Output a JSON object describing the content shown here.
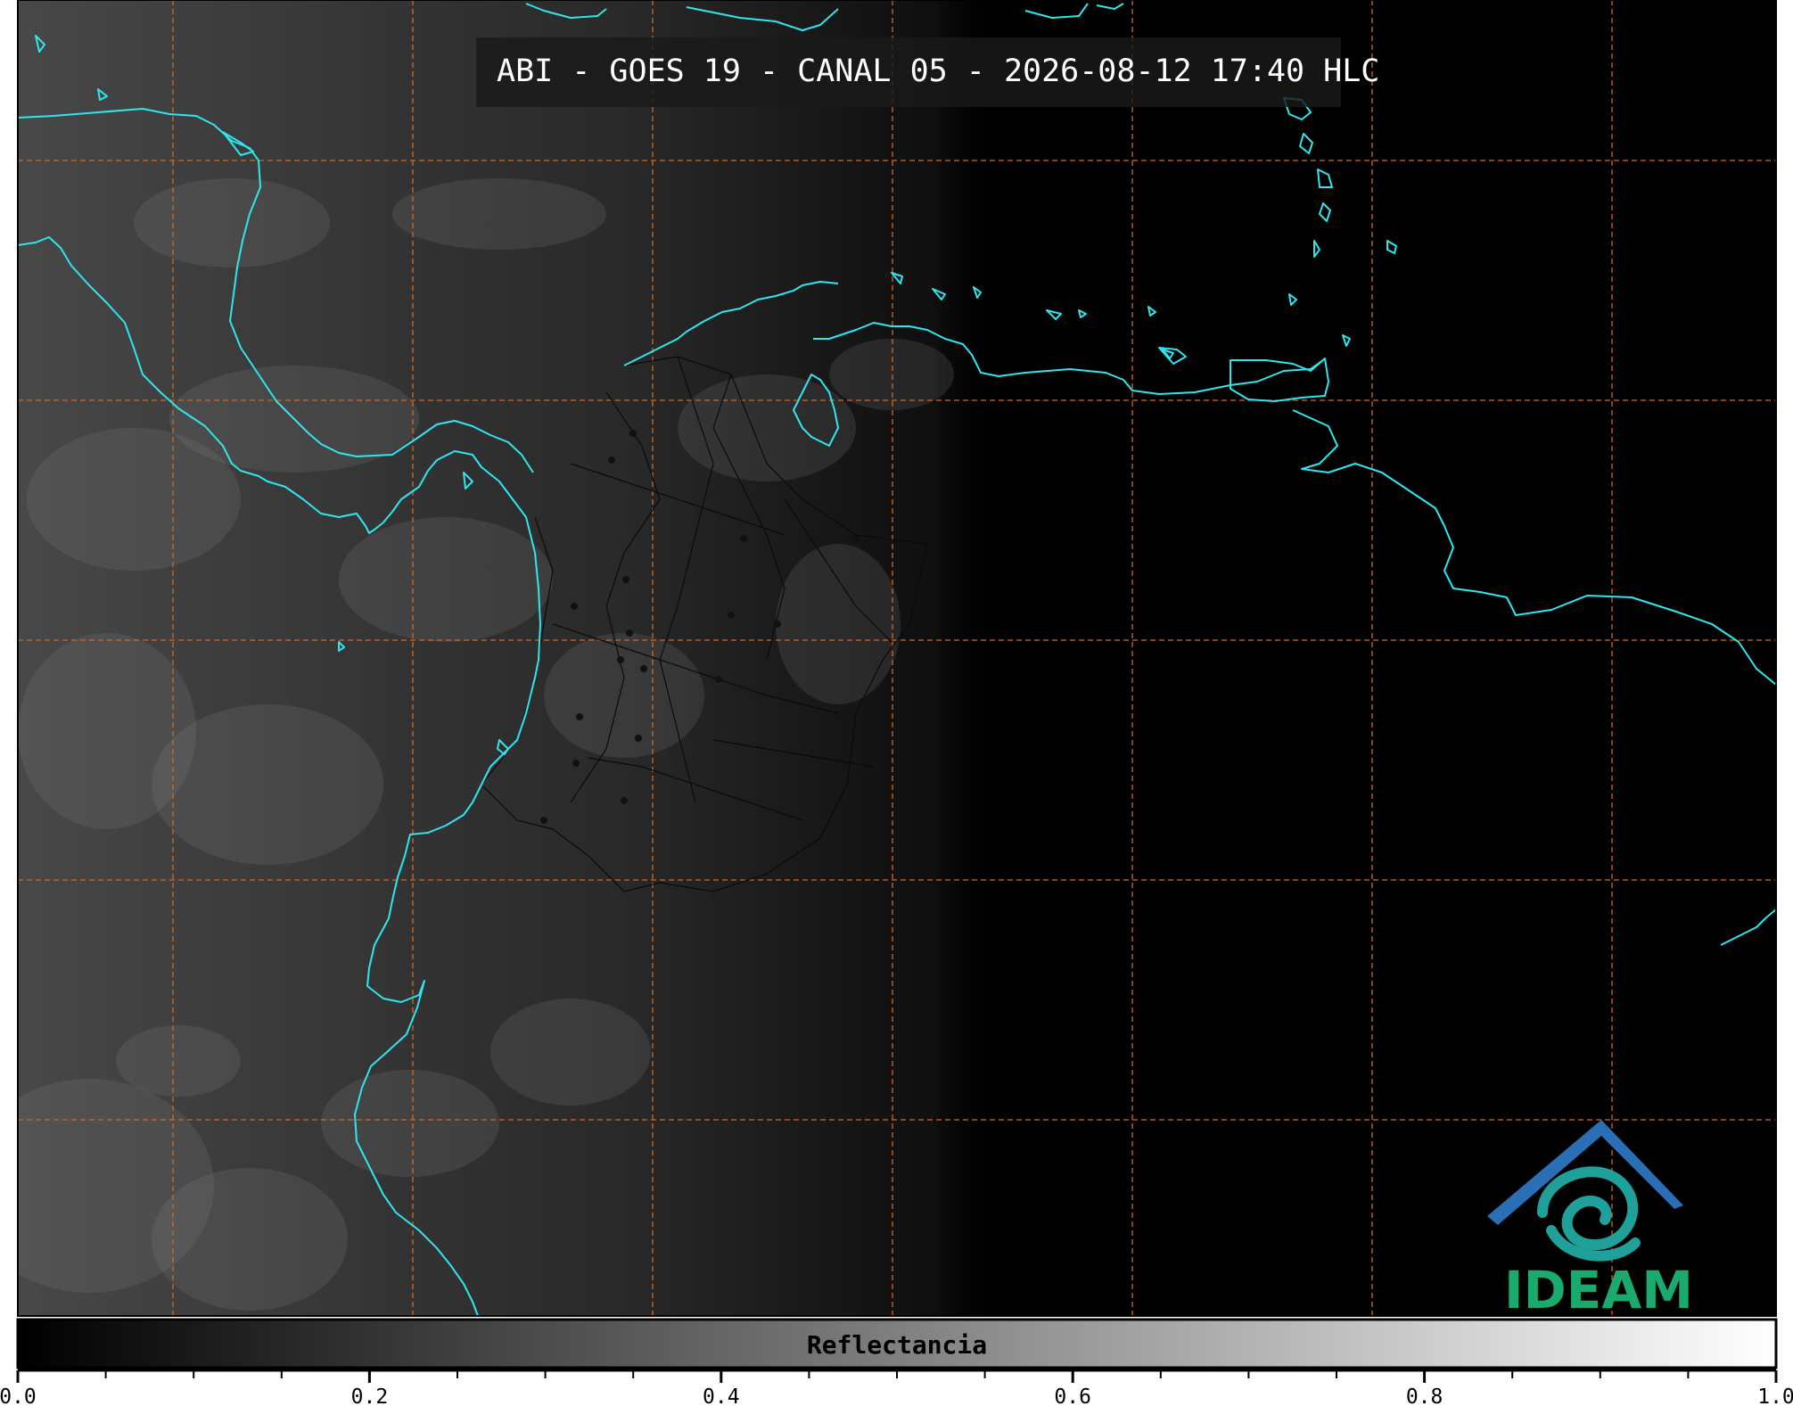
{
  "title": "ABI - GOES 19 - CANAL 05 - 2026-08-12 17:40 HLC",
  "colorbar": {
    "label": "Reflectancia",
    "min": 0.0,
    "max": 1.0,
    "ticks": [
      "0.0",
      "0.2",
      "0.4",
      "0.6",
      "0.8",
      "1.0"
    ],
    "minor_tick_step": 0.05,
    "color_low": "#000000",
    "color_high": "#ffffff"
  },
  "logo": {
    "text": "IDEAM",
    "roof_color": "#2a6fb5",
    "swirl_color": "#1fa09a",
    "text_color": "#1aaa6e"
  },
  "map": {
    "background": "#000000",
    "coastline_color": "#2ee6f0",
    "graticule_color": "#d2691e",
    "border_color": "#000000"
  }
}
